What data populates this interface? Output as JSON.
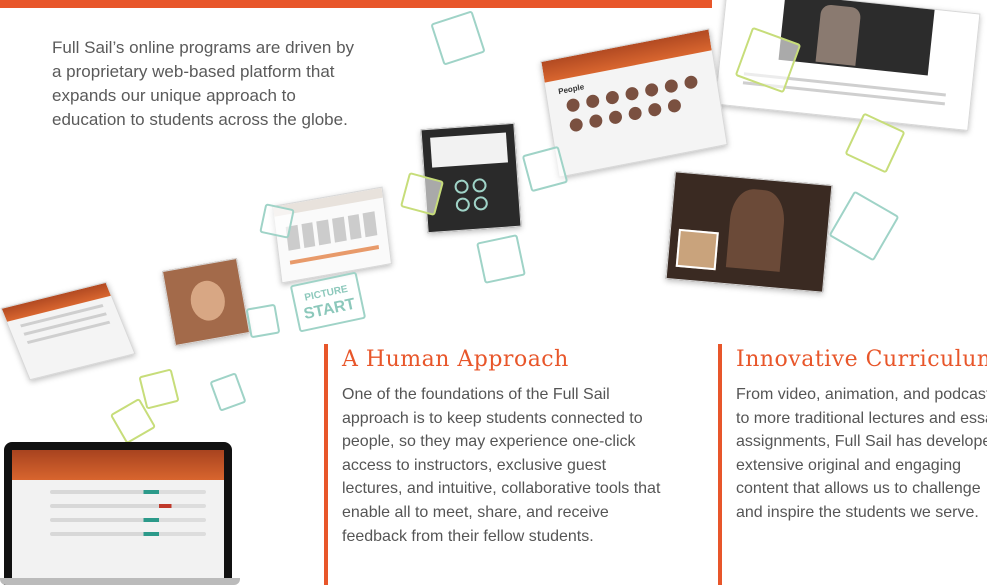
{
  "intro": {
    "text": "Full Sail’s online programs are driven by a proprietary web-based platform that expands our unique approach to education to students across the globe."
  },
  "sections": {
    "human": {
      "title": "A Human Approach",
      "body": "One of the foundations of the Full Sail approach is to keep students connected to people, so they may experience one-click access to instructors, exclusive guest lectures, and intuitive, collaborative tools that enable all to meet, share, and receive feedback from their fellow students."
    },
    "curriculum": {
      "title": "Innovative Curriculum",
      "body": "From video, animation, and podcasts, to more traditional lectures and essay assignments, Full Sail has developed extensive original and engaging content that allows us to challenge and inspire the students we serve."
    }
  },
  "decor": {
    "picture_start_badge": [
      "PICTURE",
      "START"
    ],
    "people_panel_title": "People",
    "accent_color": "#e8562a",
    "icon_colors": [
      "#9fd3c7",
      "#c7dd7a"
    ]
  }
}
